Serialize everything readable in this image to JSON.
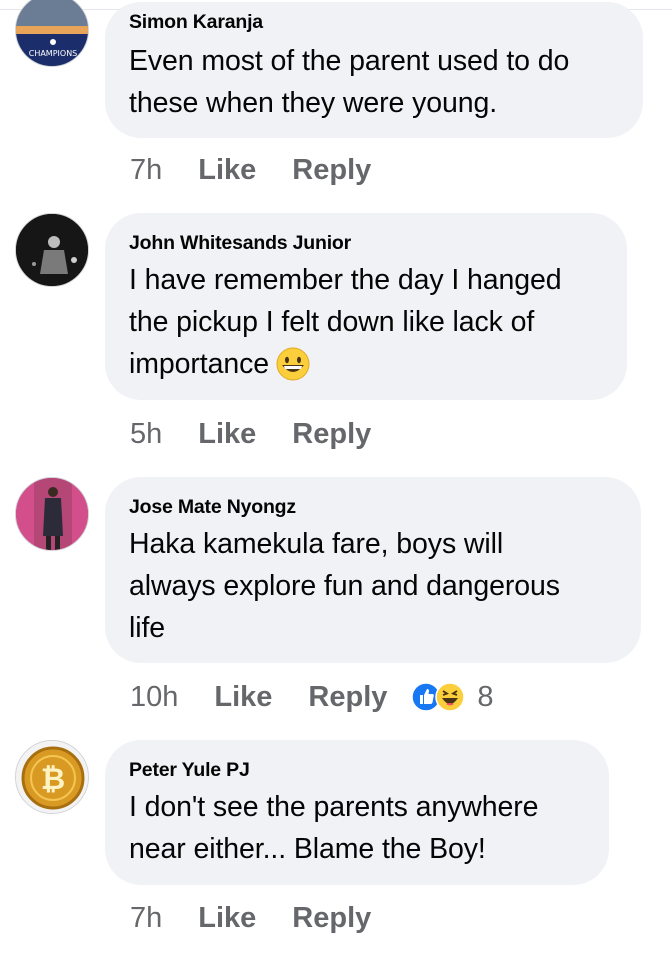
{
  "comments": [
    {
      "author": "Simon Karanja",
      "text": "Even most of the parent used to do\nthese when they were young.",
      "time": "7h",
      "like_label": "Like",
      "reply_label": "Reply"
    },
    {
      "author": "John Whitesands Junior",
      "text": "I have remember the day I hanged\nthe pickup I felt down like lack of\nimportance",
      "emoji": "grinning-face",
      "time": "5h",
      "like_label": "Like",
      "reply_label": "Reply"
    },
    {
      "author": "Jose Mate Nyongz",
      "text": "Haka kamekula fare, boys will\nalways explore fun and dangerous\nlife",
      "time": "10h",
      "like_label": "Like",
      "reply_label": "Reply",
      "reactions": {
        "icons": [
          "like-reaction-icon",
          "haha-reaction-icon"
        ],
        "count": "8"
      }
    },
    {
      "author": "Peter Yule PJ",
      "text": "I don't see the parents anywhere\nnear either... Blame the Boy!",
      "time": "7h",
      "like_label": "Like",
      "reply_label": "Reply"
    }
  ],
  "colors": {
    "bubble": "#f0f2f5",
    "meta_text": "#65676b",
    "like_blue": "#1877f2",
    "emoji_yellow": "#fbcf3b"
  }
}
